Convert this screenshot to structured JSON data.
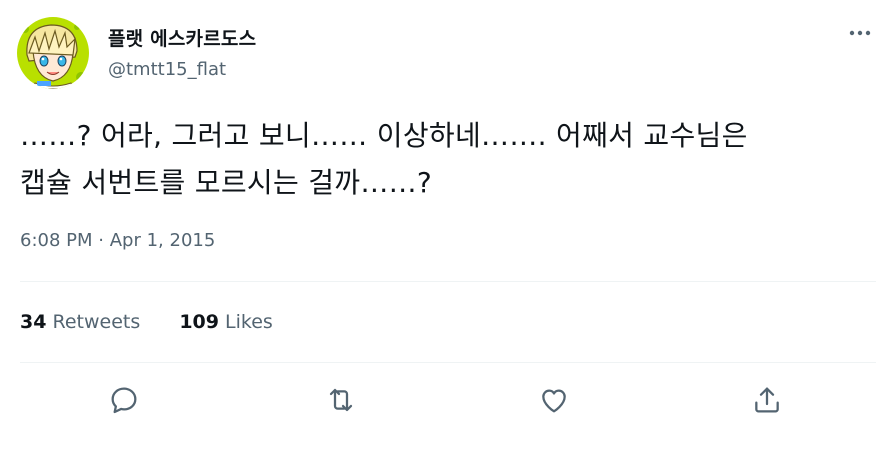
{
  "author": {
    "display_name": "플랫 에스카르도스",
    "handle": "@tmtt15_flat",
    "avatar_icon": "anime-character-avatar",
    "more_icon": "more-horizontal-icon"
  },
  "tweet": {
    "text_lines": [
      "……? 어라, 그러고 보니…… 이상하네……. 어째서 교수님은",
      "캡슐 서번트를 모르시는 걸까……?"
    ],
    "time": "6:08 PM",
    "separator": "·",
    "date": "Apr 1, 2015"
  },
  "stats": {
    "retweets": {
      "count": "34",
      "label": "Retweets"
    },
    "likes": {
      "count": "109",
      "label": "Likes"
    }
  },
  "actions": [
    {
      "name": "reply",
      "icon": "reply-icon"
    },
    {
      "name": "retweet",
      "icon": "retweet-icon"
    },
    {
      "name": "like",
      "icon": "heart-icon"
    },
    {
      "name": "share",
      "icon": "share-icon"
    }
  ],
  "colors": {
    "text": "#0f1419",
    "secondary": "#536471",
    "divider": "#eff3f4",
    "icon": "#536471"
  }
}
